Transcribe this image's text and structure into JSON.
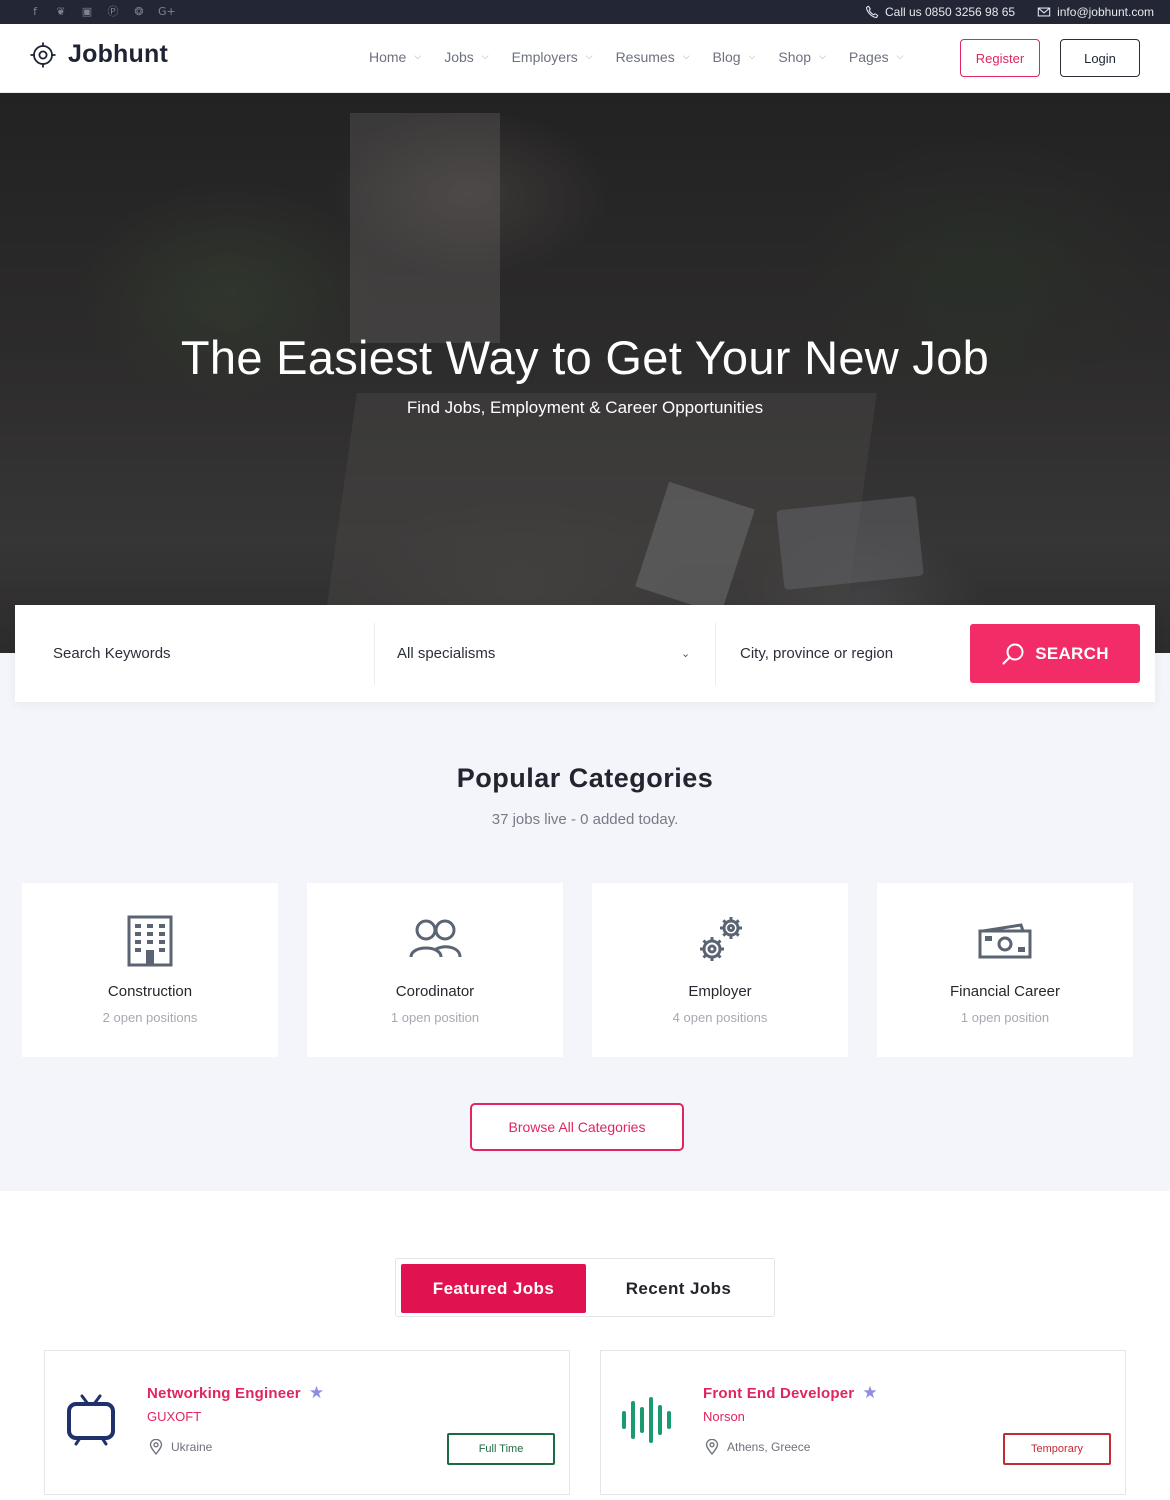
{
  "topbar": {
    "social_icons": [
      "facebook-icon",
      "twitter-icon",
      "instagram-icon",
      "pinterest-icon",
      "dribbble-icon",
      "google-plus-icon"
    ],
    "social_glyphs": [
      "f",
      "❦",
      "▣",
      "Ⓟ",
      "❂",
      "G+"
    ],
    "phone": "Call us 0850 3256 98 65",
    "email": "info@jobhunt.com"
  },
  "header": {
    "logo_text": "Jobhunt",
    "nav": [
      "Home",
      "Jobs",
      "Employers",
      "Resumes",
      "Blog",
      "Shop",
      "Pages"
    ],
    "register_label": "Register",
    "login_label": "Login"
  },
  "hero": {
    "title": "The Easiest Way to Get Your New Job",
    "subtitle": "Find Jobs, Employment & Career Opportunities"
  },
  "search": {
    "keywords_placeholder": "Search Keywords",
    "specialism_selected": "All specialisms",
    "location_placeholder": "City, province or region",
    "button_label": "SEARCH"
  },
  "categories": {
    "title": "Popular Categories",
    "subtitle": "37 jobs live - 0 added today.",
    "items": [
      {
        "name": "Construction",
        "positions": "2 open positions",
        "icon": "building-icon"
      },
      {
        "name": "Corodinator",
        "positions": "1 open position",
        "icon": "users-icon"
      },
      {
        "name": "Employer",
        "positions": "4 open positions",
        "icon": "gears-icon"
      },
      {
        "name": "Financial Career",
        "positions": "1 open position",
        "icon": "money-icon"
      }
    ],
    "browse_label": "Browse All Categories"
  },
  "jobs": {
    "tabs": [
      "Featured Jobs",
      "Recent Jobs"
    ],
    "active_tab": "Featured Jobs",
    "items": [
      {
        "title": "Networking Engineer",
        "company": "GUXOFT",
        "location": "Ukraine",
        "type": "Full Time",
        "logo": "tv-icon"
      },
      {
        "title": "Front End Developer",
        "company": "Norson",
        "location": "Athens, Greece",
        "type": "Temporary",
        "logo": "soundwave-icon"
      }
    ]
  },
  "colors": {
    "accent": "#e0265f",
    "search_button": "#f22c67",
    "topbar_bg": "#232735",
    "section_bg": "#f4f5fa",
    "full_time": "#1d6b43",
    "temporary": "#c22a36",
    "star": "#8e8de0"
  }
}
